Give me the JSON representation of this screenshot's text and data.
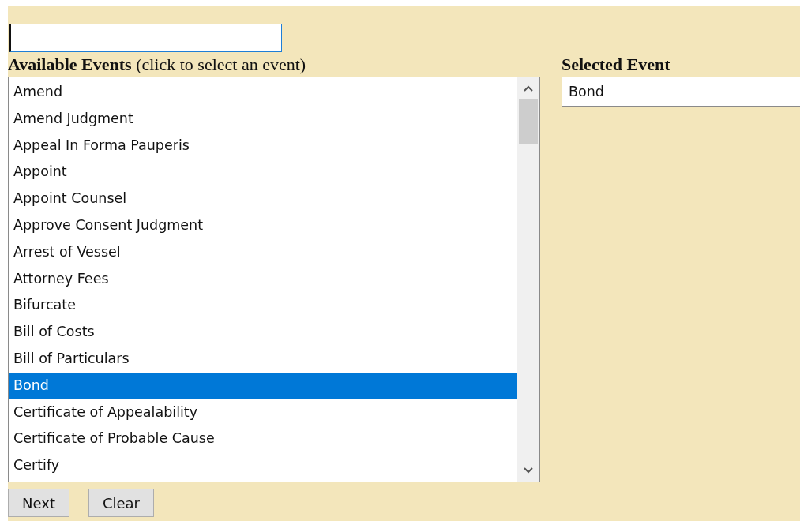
{
  "search": {
    "focused": true
  },
  "available_events": {
    "heading": "**Available Events** (click to select an event)",
    "items": [
      {
        "label": "Amend",
        "selected": false
      },
      {
        "label": "Amend Judgment",
        "selected": false
      },
      {
        "label": "Appeal In Forma Pauperis",
        "selected": false
      },
      {
        "label": "Appoint",
        "selected": false
      },
      {
        "label": "Appoint Counsel",
        "selected": false
      },
      {
        "label": "Approve Consent Judgment",
        "selected": false
      },
      {
        "label": "Arrest of Vessel",
        "selected": false
      },
      {
        "label": "Attorney Fees",
        "selected": false
      },
      {
        "label": "Bifurcate",
        "selected": false
      },
      {
        "label": "Bill of Costs",
        "selected": false
      },
      {
        "label": "Bill of Particulars",
        "selected": false
      },
      {
        "label": "Bond",
        "selected": true
      },
      {
        "label": "Certificate of Appealability",
        "selected": false
      },
      {
        "label": "Certificate of Probable Cause",
        "selected": false
      },
      {
        "label": "Certify",
        "selected": false
      }
    ]
  },
  "selected_event": {
    "heading": "Selected Event",
    "value": "Bond"
  },
  "buttons": [
    "Next",
    "Clear"
  ]
}
